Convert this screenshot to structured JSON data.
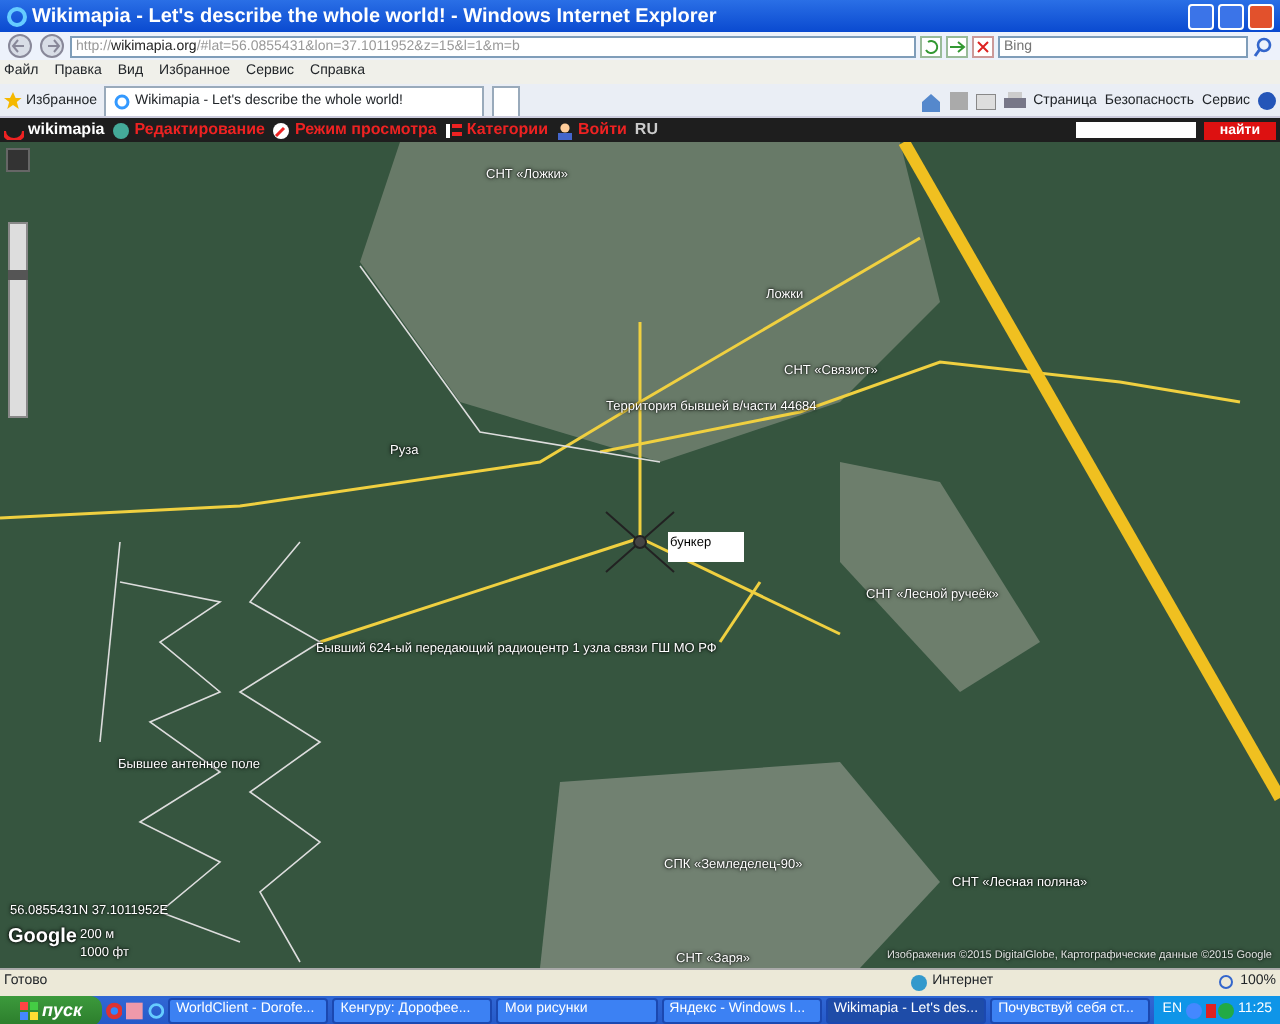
{
  "window": {
    "title": "Wikimapia - Let's describe the whole world! - Windows Internet Explorer"
  },
  "address": {
    "prefix": "http://",
    "host": "wikimapia.org",
    "rest": "/#lat=56.0855431&lon=37.1011952&z=15&l=1&m=b"
  },
  "search": {
    "placeholder": "Bing"
  },
  "menu": [
    "Файл",
    "Правка",
    "Вид",
    "Избранное",
    "Сервис",
    "Справка"
  ],
  "favorites": "Избранное",
  "tabs": [
    {
      "label": "Wikimapia - Let's describe the whole world!",
      "selected": true
    }
  ],
  "commands": [
    "Страница",
    "Безопасность",
    "Сервис"
  ],
  "site_bar": {
    "logo": "wikimapia",
    "items": [
      {
        "kind": "globe",
        "label": "Редактирование"
      },
      {
        "kind": "compass",
        "label": "Режим просмотра"
      },
      {
        "kind": "list",
        "label": "Категории"
      },
      {
        "kind": "person",
        "label": "Войти"
      }
    ],
    "language": "RU",
    "search_button": "найти"
  },
  "map": {
    "labels": [
      {
        "text": "СНТ «Ложки»",
        "kind": "plain"
      },
      {
        "text": "Ложки",
        "kind": "plain"
      },
      {
        "text": "СНТ «Связист»",
        "kind": "plain"
      },
      {
        "text": "Территория бывшей в/части 44684",
        "kind": "plain"
      },
      {
        "text": "Руза",
        "kind": "plain"
      },
      {
        "text": "бункер",
        "kind": "note"
      },
      {
        "text": "Бывший 624-ый передающий радиоцентр 1 узла связи ГШ МО РФ",
        "kind": "plain"
      },
      {
        "text": "СНТ «Лесной ручеёк»",
        "kind": "plain"
      },
      {
        "text": "Бывшее антенное поле",
        "kind": "plain"
      },
      {
        "text": "СПК «Земледелец-90»",
        "kind": "plain"
      },
      {
        "text": "СНТ «Лесная поляна»",
        "kind": "plain"
      },
      {
        "text": "СНТ «Заря»",
        "kind": "plain"
      }
    ],
    "zoom_slider": {
      "level": 0.75
    },
    "coordinates": "56.0855431N 37.1011952E",
    "provider": "Google",
    "scale": [
      "200 м",
      "1000 фт"
    ],
    "copyright": "Изображения ©2015 DigitalGlobe, Картографические данные ©2015 Google"
  },
  "status_bar": {
    "text": "Готово",
    "zone": "Интернет",
    "zoom": "100%"
  },
  "taskbar": {
    "start": "пуск",
    "tasks": [
      {
        "label": "WorldClient - Dorofe...",
        "selected": false
      },
      {
        "label": "Кенгуру: Дорофее...",
        "selected": false
      },
      {
        "label": "Мои рисунки",
        "selected": false
      },
      {
        "label": "Яндекс - Windows I...",
        "selected": false
      },
      {
        "label": "Wikimapia - Let's des...",
        "selected": true
      },
      {
        "label": "Почувствуй себя ст...",
        "selected": false
      }
    ],
    "language": "EN",
    "clock": "11:25"
  }
}
